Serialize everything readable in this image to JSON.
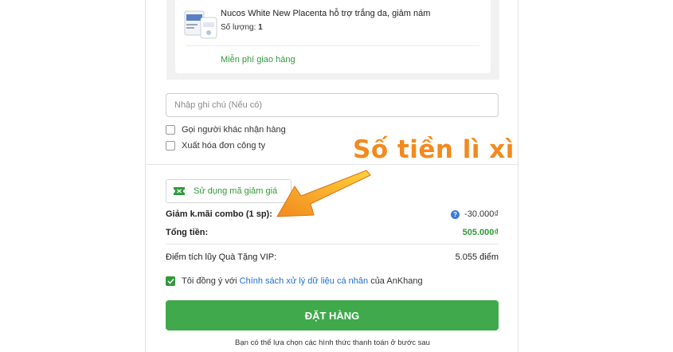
{
  "product": {
    "name": "Nucos White New Placenta hỗ trợ trắng da, giảm nám",
    "qty_label": "Số lượng:",
    "qty_value": "1",
    "shipping": "Miễn phí giao hàng"
  },
  "note": {
    "placeholder": "Nhập ghi chú (Nếu có)"
  },
  "options": [
    {
      "label": "Gọi người khác nhận hàng",
      "checked": false
    },
    {
      "label": "Xuất hóa đơn công ty",
      "checked": false
    }
  ],
  "voucher": {
    "label": "Sử dụng mã giảm giá",
    "icon": "ticket-icon"
  },
  "summary": {
    "discount_label": "Giảm k.mãi combo (1 sp):",
    "discount_value": "-30.000₫",
    "total_label": "Tổng tiền:",
    "total_value": "505.000₫",
    "points_label": "Điểm tích lũy Quà Tặng VIP:",
    "points_value": "5.055 điểm"
  },
  "consent": {
    "prefix": "Tôi đồng ý với",
    "link": "Chính sách xử lý dữ liệu cá nhân",
    "suffix": "của AnKhang",
    "checked": true
  },
  "order_button": "ĐẶT HÀNG",
  "footnote": "Bạn có thể lựa chọn các hình thức thanh toán ở bước sau",
  "annotation": {
    "text": "Số tiền lì xì"
  },
  "colors": {
    "green": "#3fa94b",
    "link": "#1f6fd1",
    "annotation": "#f28a1e"
  }
}
